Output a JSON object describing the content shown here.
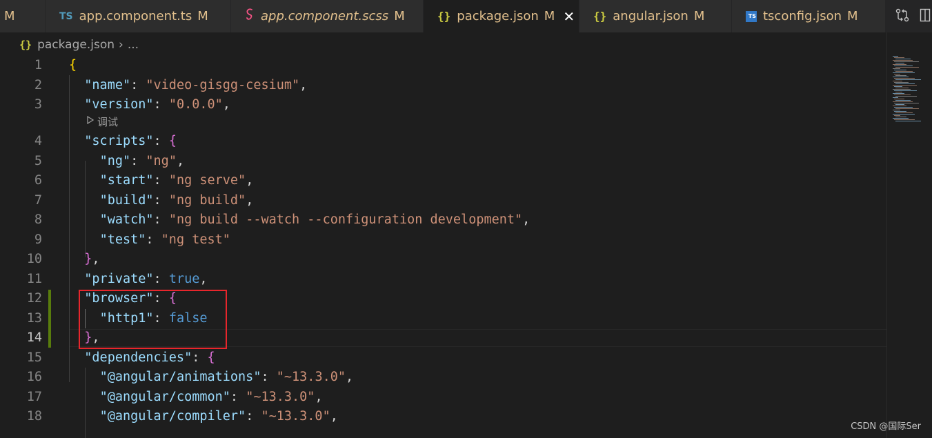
{
  "tabs": [
    {
      "icon": "",
      "label": "",
      "modified": "M",
      "italic": false,
      "active": false
    },
    {
      "icon": "TS",
      "label": "app.component.ts",
      "modified": "M",
      "italic": false,
      "active": false
    },
    {
      "icon": "",
      "label": "app.component.scss",
      "modified": "M",
      "italic": true,
      "active": false
    },
    {
      "icon": "{}",
      "label": "package.json",
      "modified": "M",
      "italic": false,
      "active": true
    },
    {
      "icon": "{}",
      "label": "angular.json",
      "modified": "M",
      "italic": false,
      "active": false
    },
    {
      "icon": "TS",
      "label": "tsconfig.json",
      "modified": "M",
      "italic": false,
      "active": false
    }
  ],
  "close_glyph": "✕",
  "breadcrumb": {
    "icon": "{}",
    "file": "package.json",
    "separator": "›",
    "more": "..."
  },
  "codelens": {
    "label": "调试"
  },
  "lines": [
    {
      "n": "1",
      "indent": "",
      "tokens": [
        [
          "br1",
          "{"
        ]
      ]
    },
    {
      "n": "2",
      "indent": "  ",
      "tokens": [
        [
          "k",
          "\"name\""
        ],
        [
          "p",
          ": "
        ],
        [
          "s",
          "\"video-gisgg-cesium\""
        ],
        [
          "p",
          ","
        ]
      ]
    },
    {
      "n": "3",
      "indent": "  ",
      "tokens": [
        [
          "k",
          "\"version\""
        ],
        [
          "p",
          ": "
        ],
        [
          "s",
          "\"0.0.0\""
        ],
        [
          "p",
          ","
        ]
      ]
    },
    {
      "n": "4",
      "indent": "  ",
      "tokens": [
        [
          "k",
          "\"scripts\""
        ],
        [
          "p",
          ": "
        ],
        [
          "br2",
          "{"
        ]
      ]
    },
    {
      "n": "5",
      "indent": "    ",
      "tokens": [
        [
          "k",
          "\"ng\""
        ],
        [
          "p",
          ": "
        ],
        [
          "s",
          "\"ng\""
        ],
        [
          "p",
          ","
        ]
      ]
    },
    {
      "n": "6",
      "indent": "    ",
      "tokens": [
        [
          "k",
          "\"start\""
        ],
        [
          "p",
          ": "
        ],
        [
          "s",
          "\"ng serve\""
        ],
        [
          "p",
          ","
        ]
      ]
    },
    {
      "n": "7",
      "indent": "    ",
      "tokens": [
        [
          "k",
          "\"build\""
        ],
        [
          "p",
          ": "
        ],
        [
          "s",
          "\"ng build\""
        ],
        [
          "p",
          ","
        ]
      ]
    },
    {
      "n": "8",
      "indent": "    ",
      "tokens": [
        [
          "k",
          "\"watch\""
        ],
        [
          "p",
          ": "
        ],
        [
          "s",
          "\"ng build --watch --configuration development\""
        ],
        [
          "p",
          ","
        ]
      ]
    },
    {
      "n": "9",
      "indent": "    ",
      "tokens": [
        [
          "k",
          "\"test\""
        ],
        [
          "p",
          ": "
        ],
        [
          "s",
          "\"ng test\""
        ]
      ]
    },
    {
      "n": "10",
      "indent": "  ",
      "tokens": [
        [
          "br2",
          "}"
        ],
        [
          "p",
          ","
        ]
      ]
    },
    {
      "n": "11",
      "indent": "  ",
      "tokens": [
        [
          "k",
          "\"private\""
        ],
        [
          "p",
          ": "
        ],
        [
          "b",
          "true"
        ],
        [
          "p",
          ","
        ]
      ]
    },
    {
      "n": "12",
      "indent": "  ",
      "tokens": [
        [
          "k",
          "\"browser\""
        ],
        [
          "p",
          ": "
        ],
        [
          "br2",
          "{"
        ]
      ]
    },
    {
      "n": "13",
      "indent": "    ",
      "tokens": [
        [
          "k",
          "\"http1\""
        ],
        [
          "p",
          ": "
        ],
        [
          "b",
          "false"
        ]
      ]
    },
    {
      "n": "14",
      "indent": "  ",
      "tokens": [
        [
          "br2",
          "}"
        ],
        [
          "p",
          ","
        ]
      ]
    },
    {
      "n": "15",
      "indent": "  ",
      "tokens": [
        [
          "k",
          "\"dependencies\""
        ],
        [
          "p",
          ": "
        ],
        [
          "br2",
          "{"
        ]
      ]
    },
    {
      "n": "16",
      "indent": "    ",
      "tokens": [
        [
          "k",
          "\"@angular/animations\""
        ],
        [
          "p",
          ": "
        ],
        [
          "s",
          "\"~13.3.0\""
        ],
        [
          "p",
          ","
        ]
      ]
    },
    {
      "n": "17",
      "indent": "    ",
      "tokens": [
        [
          "k",
          "\"@angular/common\""
        ],
        [
          "p",
          ": "
        ],
        [
          "s",
          "\"~13.3.0\""
        ],
        [
          "p",
          ","
        ]
      ]
    },
    {
      "n": "18",
      "indent": "    ",
      "tokens": [
        [
          "k",
          "\"@angular/compiler\""
        ],
        [
          "p",
          ": "
        ],
        [
          "s",
          "\"~13.3.0\""
        ],
        [
          "p",
          ","
        ]
      ]
    }
  ],
  "current_line": "14",
  "watermark": "CSDN @国际Ser",
  "colors": {
    "editor_bg": "#1e1e1e",
    "tab_bg": "#2d2d2d",
    "modified_text": "#e2c08d",
    "json_key": "#9cdcfe",
    "json_string": "#ce9178",
    "json_bool": "#569cd6",
    "bracket_level1": "#ffd700",
    "bracket_level2": "#da70d6",
    "highlight_box": "#e8262c",
    "gutter_modified": "#587c0c"
  }
}
